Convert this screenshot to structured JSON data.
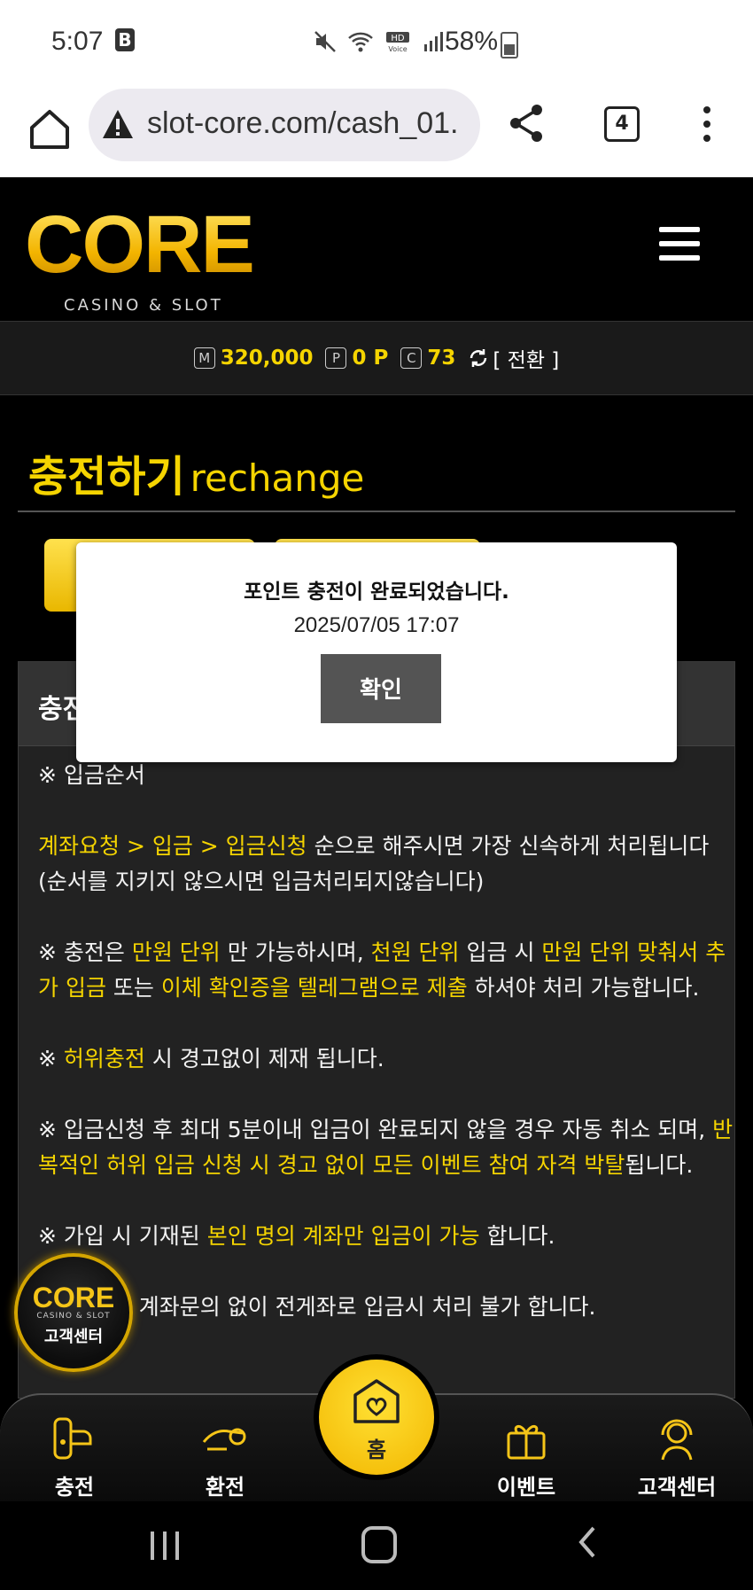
{
  "status_bar": {
    "time": "5:07",
    "battery": "58%"
  },
  "browser": {
    "url": "slot-core.com/cash_01.",
    "tab_count": "4"
  },
  "site": {
    "logo": "CORE",
    "logo_sub": "CASINO & SLOT"
  },
  "balance": {
    "money_badge": "M",
    "money": "320,000",
    "point_badge": "P",
    "point": "0 P",
    "coin_badge": "C",
    "coin": "73",
    "convert_label": "[ 전환 ]"
  },
  "page": {
    "title": "충전하기",
    "title_en": "rechange"
  },
  "content": {
    "header_label": "충전",
    "section_heading": "※ 입금순서",
    "p1_steps": "계좌요청 > 입금 > 입금신청",
    "p1_rest": " 순으로 해주시면 가장 신속하게 처리됩니다 (순서를 지키지 않으시면 입금처리되지않습니다)",
    "p2_a": "※ 충전은 ",
    "p2_b": "만원 단위",
    "p2_c": " 만 가능하시며, ",
    "p2_d": "천원 단위",
    "p2_e": " 입금 시 ",
    "p2_f": "만원 단위 맞춰서 추가 입금",
    "p2_g": " 또는 ",
    "p2_h": "이체 확인증을 텔레그램으로 제출",
    "p2_i": " 하셔야 처리 가능합니다.",
    "p3_a": "※ ",
    "p3_b": "허위충전",
    "p3_c": " 시 경고없이 제재 됩니다.",
    "p4_a": "※ 입금신청 후 최대 5분이내 입금이 완료되지 않을 경우 자동 취소 되며, ",
    "p4_b": "반복적인 허위 입금 신청 시 경고 없이 모든 이벤트 참여 자격 박탈",
    "p4_c": "됩니다.",
    "p5_a": "※ 가입 시 기재된 ",
    "p5_b": "본인 명의 계좌만 입금이 가능",
    "p5_c": " 합니다.",
    "p6": "※ 입금 전 계좌문의 없이 전게좌로 입금시 처리 불가 합니다."
  },
  "cs_badge": {
    "logo": "CORE",
    "sub": "CASINO & SLOT",
    "label": "고객센터"
  },
  "bottom_nav": {
    "charge": "충전",
    "exchange": "환전",
    "home": "홈",
    "event": "이벤트",
    "support": "고객센터"
  },
  "modal": {
    "message": "포인트 충전이 완료되었습니다.",
    "timestamp": "2025/07/05 17:07",
    "confirm": "확인"
  },
  "colors": {
    "accent": "#f5d400",
    "background": "#000000",
    "panel": "#222222"
  }
}
